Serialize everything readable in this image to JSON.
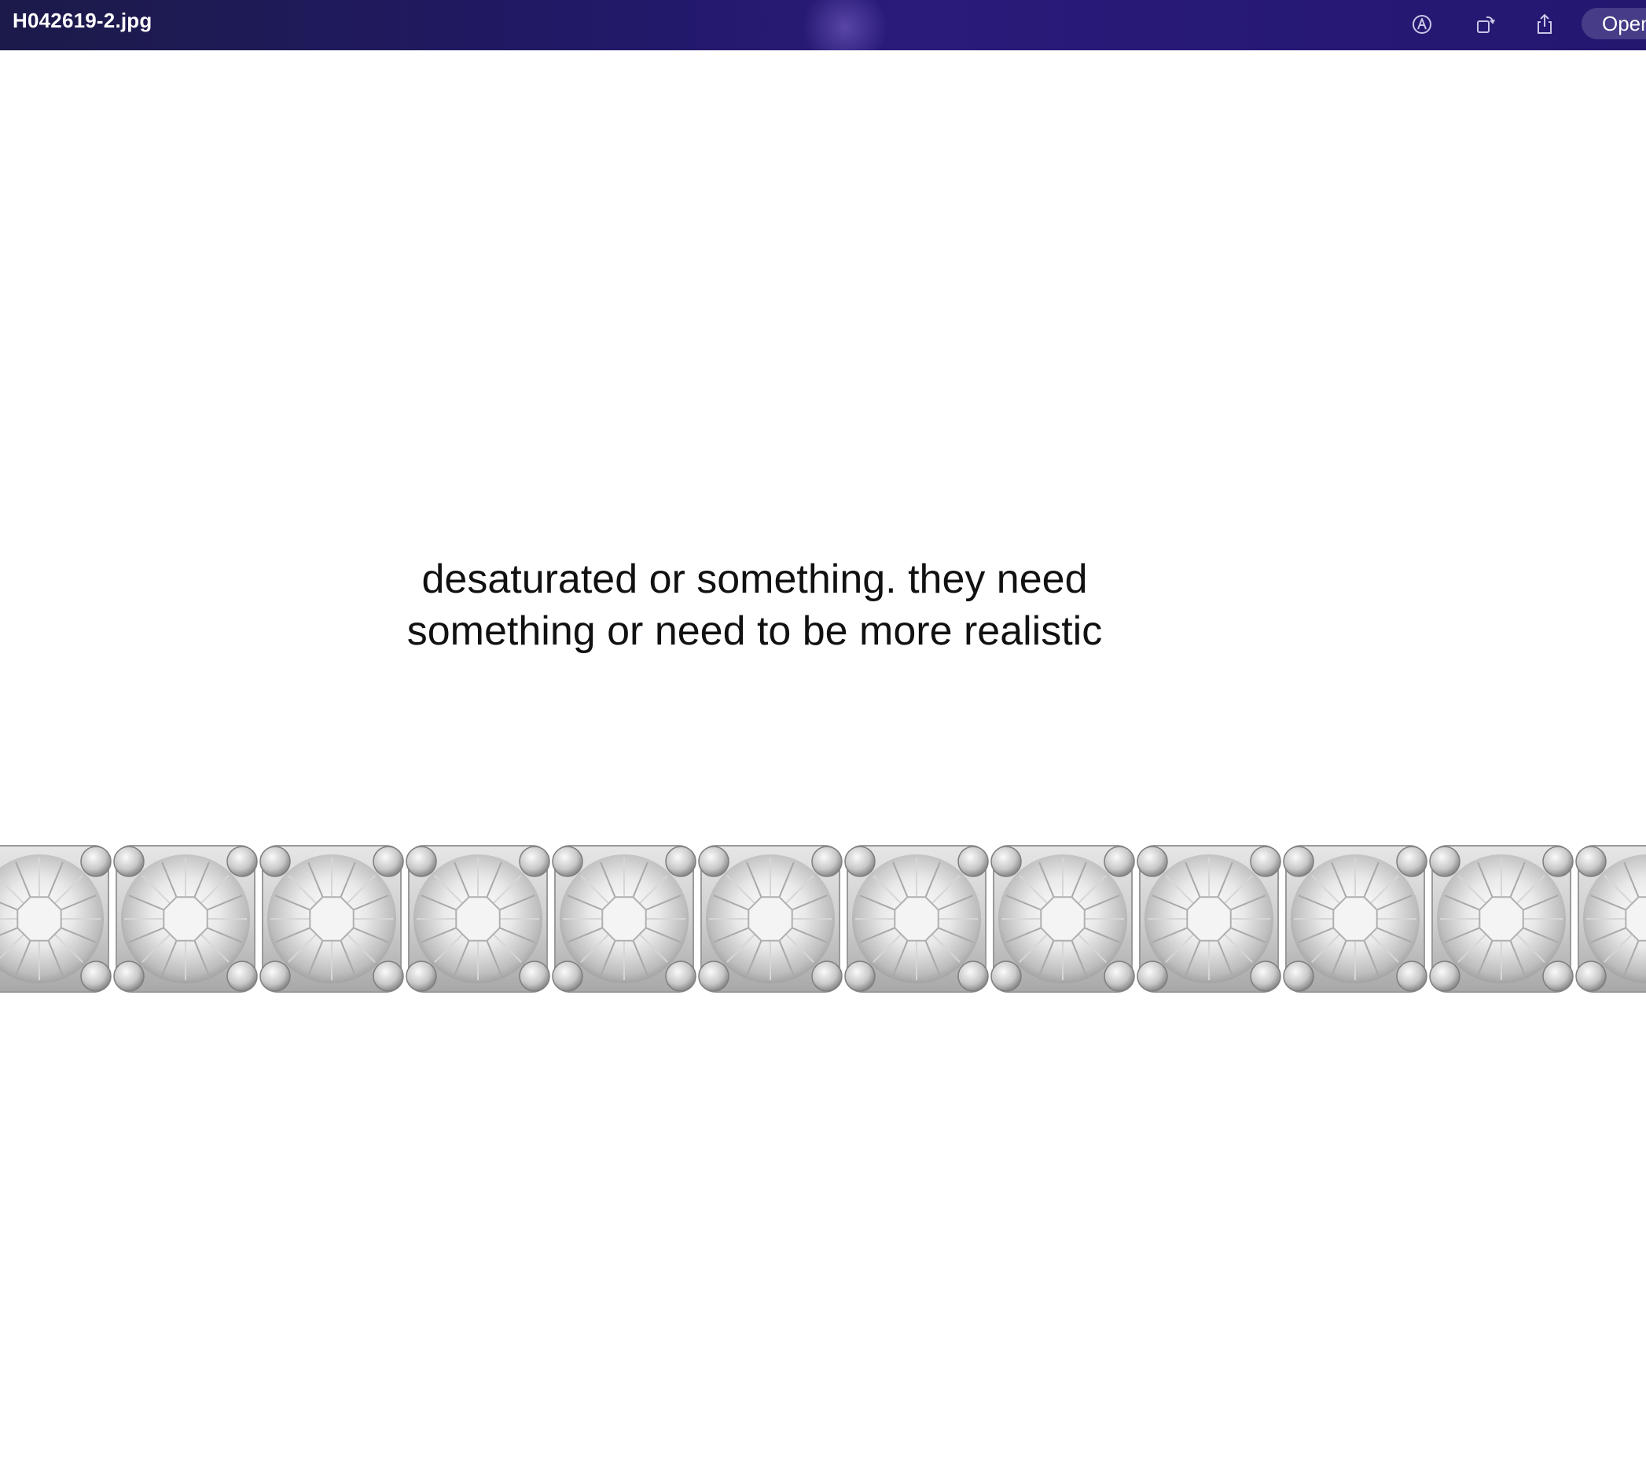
{
  "window": {
    "title": "H042619-2.jpg",
    "open_label": "Open"
  },
  "toolbar": {
    "icons": [
      "markup-icon",
      "rotate-icon",
      "share-icon"
    ]
  },
  "image": {
    "caption_line1": "desaturated or something. they need",
    "caption_line2": "something or need to be more realistic",
    "subject": "diamond tennis bracelet",
    "stone_count": 12
  }
}
